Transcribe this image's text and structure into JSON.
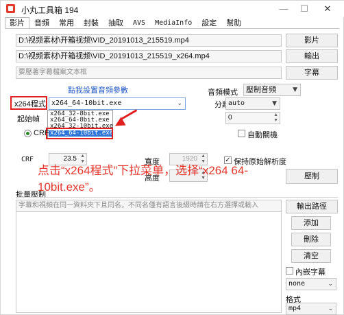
{
  "window": {
    "title": "小丸工具箱 194",
    "minimize": "—",
    "maximize": "☐",
    "close": "✕"
  },
  "tabs": [
    {
      "label": "影片",
      "active": true
    },
    {
      "label": "音頻"
    },
    {
      "label": "常用"
    },
    {
      "label": "封裝"
    },
    {
      "label": "抽取"
    },
    {
      "label": "AVS"
    },
    {
      "label": "MediaInfo"
    },
    {
      "label": "設定"
    },
    {
      "label": "幫助"
    }
  ],
  "files": {
    "input_path": "D:\\视频素材\\开箱视频\\VID_20191013_215519.mp4",
    "output_path": "D:\\视频素材\\开箱视频\\VID_20191013_215519_x264.mp4",
    "subtitle_placeholder": "要壓著字幕檔案文本框",
    "video_button": "影片",
    "output_button": "輸出",
    "subtitle_button": "字幕"
  },
  "encode": {
    "audio_link": "點我設置音頻參數",
    "x264_label": "x264程式",
    "x264_selected": "x264_64-10bit.exe",
    "x264_options": [
      "x264_32-8bit.exe",
      "x264_64-8bit.exe",
      "x264_32-10bit.exe",
      "x264_64-10bit.exe"
    ],
    "start_label": "起始幀",
    "crf_label": "CRF",
    "audio_mode_label": "音頻模式",
    "audio_mode_value": "壓制音頻",
    "separator_label": "分離器",
    "separator_value": "auto",
    "spin_value": "0",
    "auto_shutdown": "自動關機",
    "crf_row_label": "CRF",
    "crf_value": "23.5",
    "width_label": "寬度",
    "width_value": "1920",
    "height_label": "高度",
    "keep_resolution": "保持原始解析度",
    "encode_button": "壓制"
  },
  "annotation": "点击“x264程式”下拉菜单，选择“x264 64-10bit.exe”。",
  "batch": {
    "section_label": "批量壓制",
    "hint": "字幕和視頻在同一資料夾下且同名，不同名僅有語言後綴時請在右方選擇或輸入",
    "output_path_button": "輸出路徑",
    "add_button": "添加",
    "delete_button": "刪除",
    "clear_button": "清空",
    "embed_subtitle": "內嵌字幕",
    "subtitle_mode": "none",
    "format_label": "格式",
    "format_value": "mp4"
  }
}
